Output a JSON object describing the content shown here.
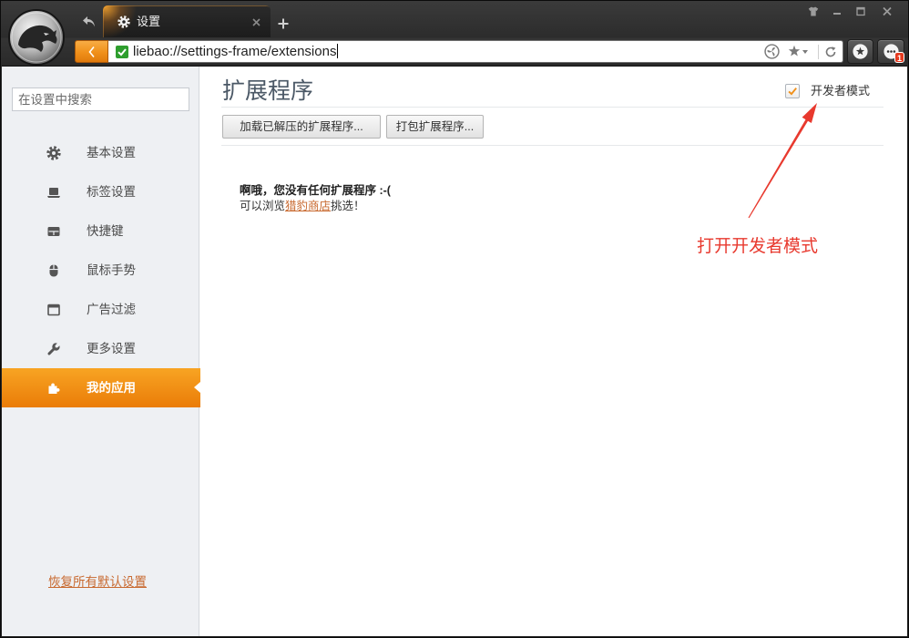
{
  "browser": {
    "tab_title": "设置",
    "address_url": "liebao://settings-frame/extensions",
    "menu_badge_count": "1"
  },
  "sidebar": {
    "search_placeholder": "在设置中搜索",
    "items": [
      {
        "label": "基本设置",
        "icon": "gear-icon",
        "active": false
      },
      {
        "label": "标签设置",
        "icon": "laptop-icon",
        "active": false
      },
      {
        "label": "快捷键",
        "icon": "shortcut-keys-icon",
        "active": false
      },
      {
        "label": "鼠标手势",
        "icon": "mouse-icon",
        "active": false
      },
      {
        "label": "广告过滤",
        "icon": "window-icon",
        "active": false
      },
      {
        "label": "更多设置",
        "icon": "wrench-icon",
        "active": false
      },
      {
        "label": "我的应用",
        "icon": "puzzle-icon",
        "active": true
      }
    ],
    "restore_defaults_link": "恢复所有默认设置"
  },
  "main": {
    "title": "扩展程序",
    "developer_mode": {
      "label": "开发者模式",
      "checked": true
    },
    "buttons": {
      "load_unpacked": "加载已解压的扩展程序...",
      "pack_extension": "打包扩展程序..."
    },
    "empty_state": {
      "headline": "啊哦，您没有任何扩展程序 :-(",
      "line_prefix": "可以浏览",
      "store_link": "猎豹商店",
      "line_suffix": "挑选！"
    }
  },
  "annotation": {
    "text": "打开开发者模式"
  },
  "colors": {
    "accent_orange": "#f0901a",
    "active_item_top": "#f8a423",
    "active_item_bottom": "#ea7c08",
    "link": "#c8692f",
    "annotation_red": "#e8392e",
    "secure_green": "#2e9e2e",
    "badge_red": "#e53a1f"
  }
}
